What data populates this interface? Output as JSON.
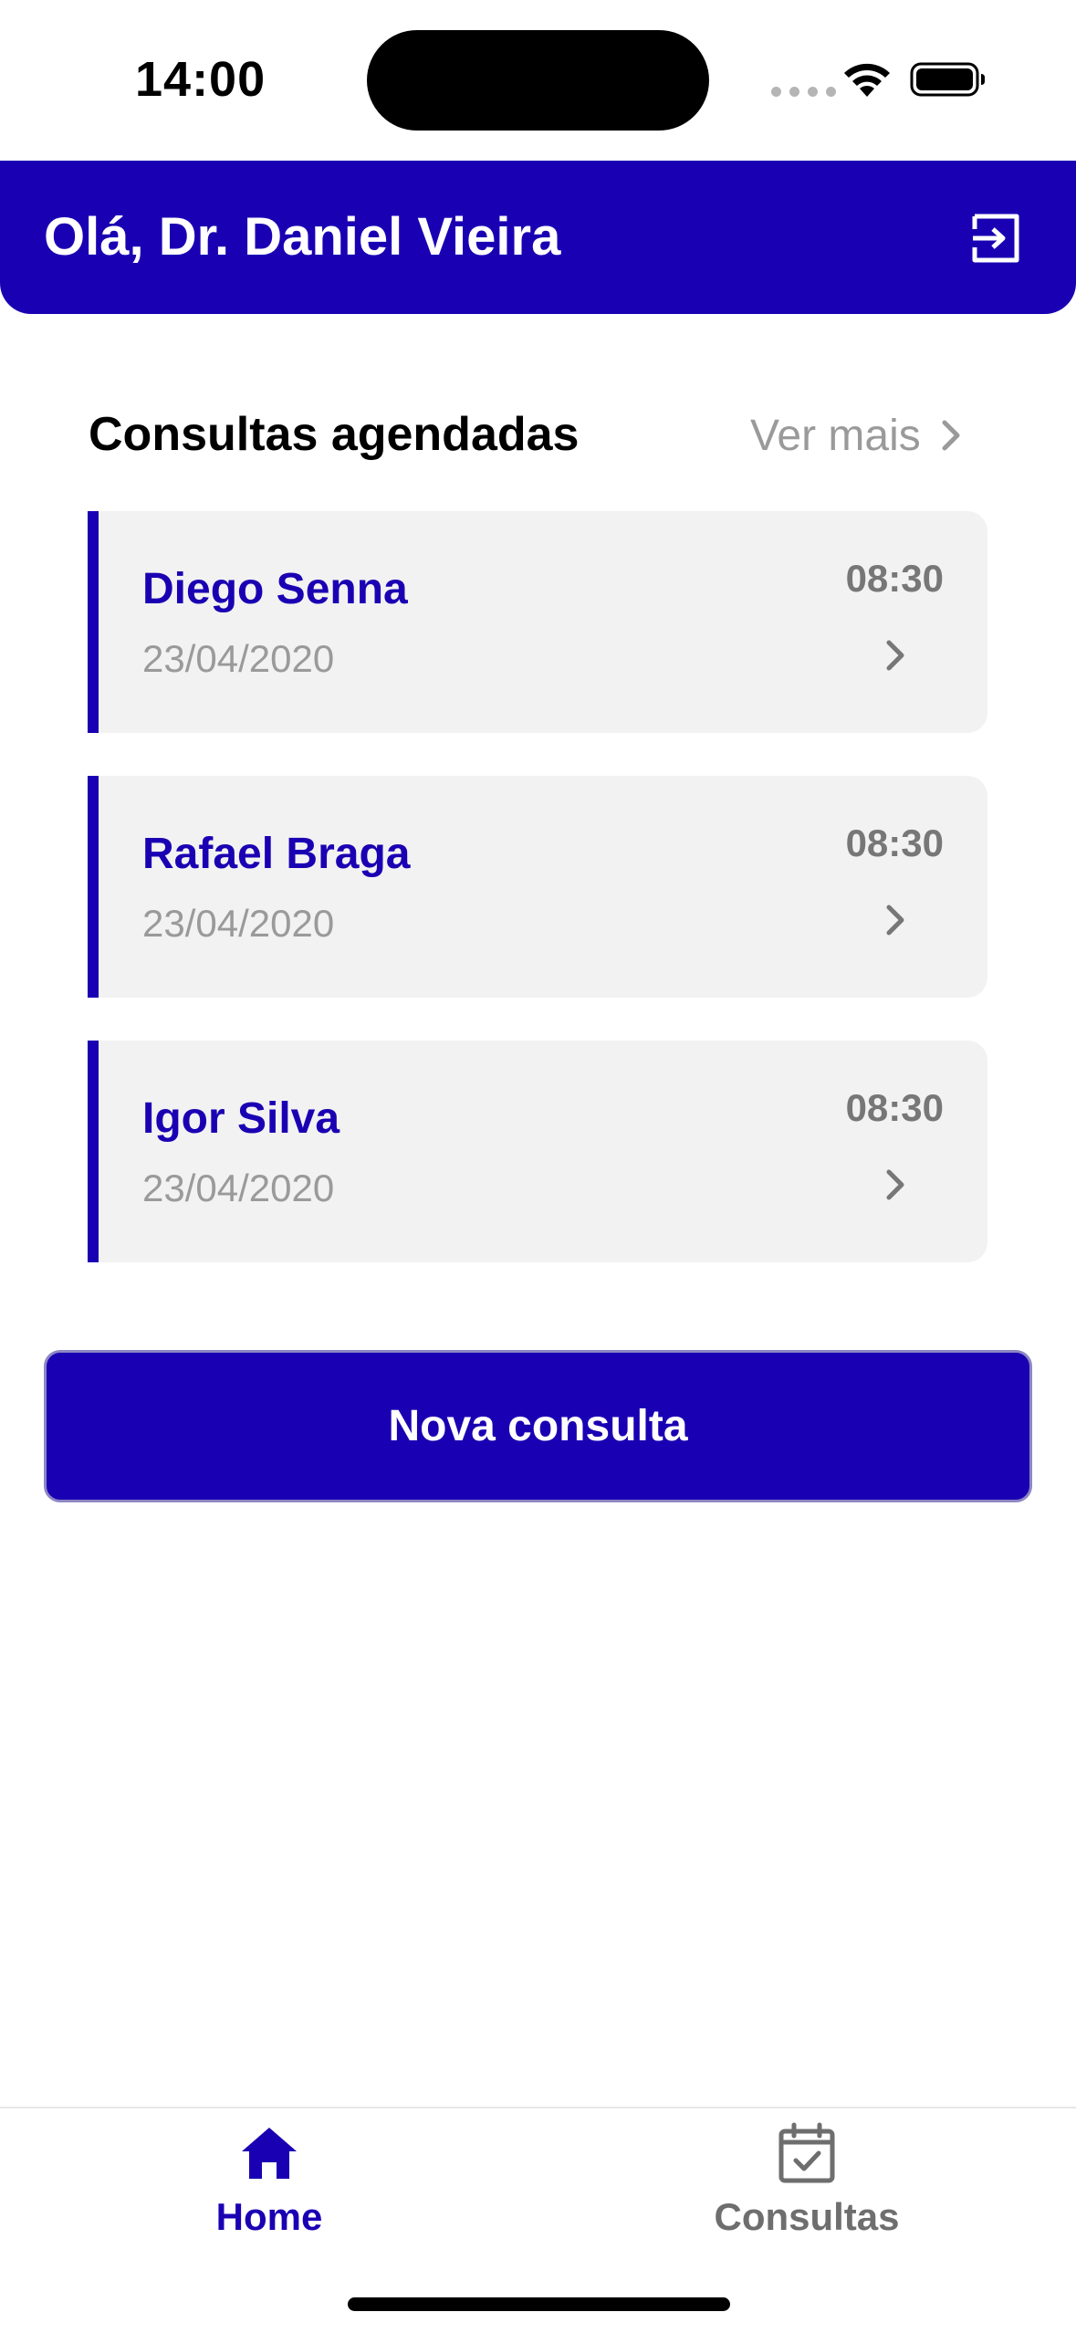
{
  "status_bar": {
    "time": "14:00"
  },
  "header": {
    "greeting": "Olá, Dr. Daniel Vieira",
    "logout_icon": "logout-icon"
  },
  "section": {
    "title": "Consultas agendadas",
    "see_more": "Ver mais"
  },
  "appointments": [
    {
      "name": "Diego Senna",
      "date": "23/04/2020",
      "time": "08:30"
    },
    {
      "name": "Rafael Braga",
      "date": "23/04/2020",
      "time": "08:30"
    },
    {
      "name": "Igor Silva",
      "date": "23/04/2020",
      "time": "08:30"
    }
  ],
  "actions": {
    "new_consultation": "Nova consulta"
  },
  "tabs": [
    {
      "label": "Home",
      "icon": "home-icon",
      "active": true
    },
    {
      "label": "Consultas",
      "icon": "calendar-check-icon",
      "active": false
    }
  ],
  "colors": {
    "primary": "#1a00b3",
    "card_bg": "#f2f2f2",
    "muted": "#9a9a9a",
    "inactive_tab": "#6e6e6e"
  }
}
